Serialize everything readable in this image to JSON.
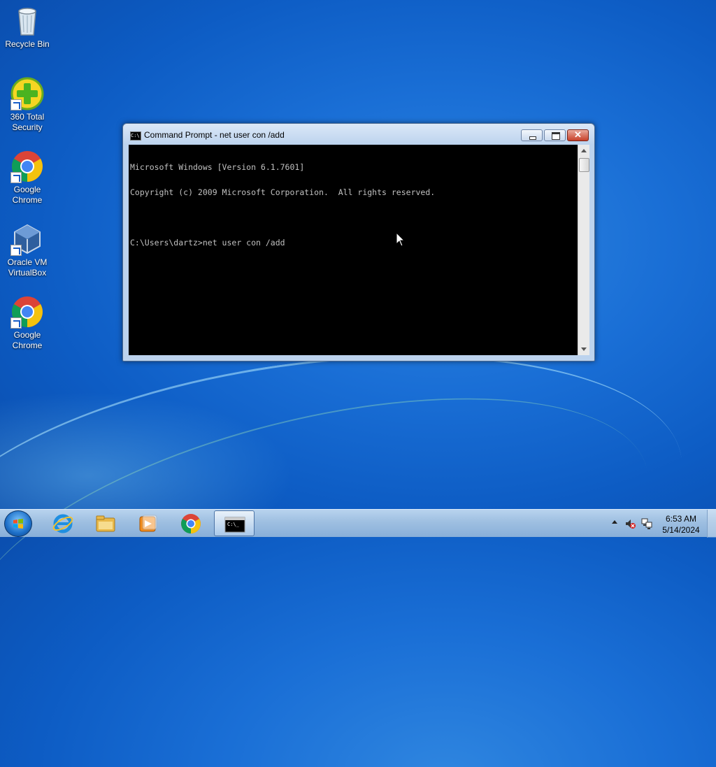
{
  "desktop": {
    "icons": [
      {
        "label_line1": "Recycle Bin",
        "label_line2": ""
      },
      {
        "label_line1": "360 Total",
        "label_line2": "Security"
      },
      {
        "label_line1": "Google",
        "label_line2": "Chrome"
      },
      {
        "label_line1": "Oracle VM",
        "label_line2": "VirtualBox"
      },
      {
        "label_line1": "Google",
        "label_line2": "Chrome"
      }
    ]
  },
  "window": {
    "title": "Command Prompt - net  user con /add",
    "icon_text": "C:\\",
    "close_symbol": "✕",
    "console_lines": [
      "Microsoft Windows [Version 6.1.7601]",
      "Copyright (c) 2009 Microsoft Corporation.  All rights reserved.",
      "",
      "C:\\Users\\dartz>net user con /add"
    ]
  },
  "taskbar": {
    "pinned": [
      "internet-explorer",
      "windows-explorer",
      "media-player",
      "google-chrome",
      "command-prompt"
    ],
    "clock_time": "6:53 AM",
    "clock_date": "5/14/2024"
  },
  "colors": {
    "desktop_bg": "#1a6fd6",
    "console_bg": "#000000",
    "console_fg": "#c0c0c0",
    "title_bar": "#bcd3ee"
  }
}
